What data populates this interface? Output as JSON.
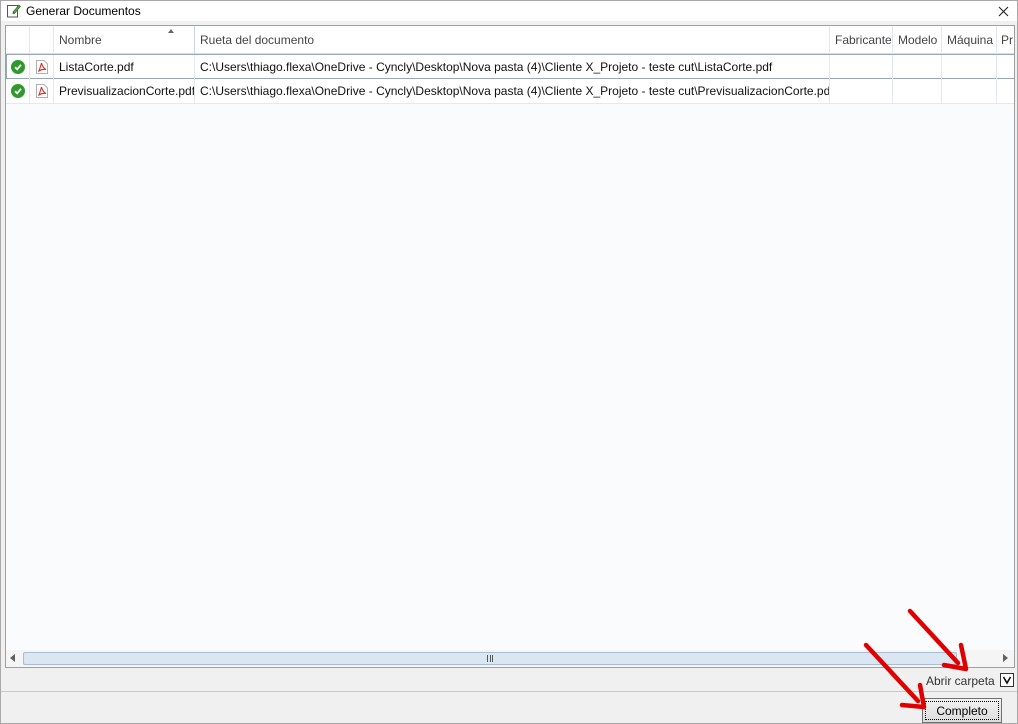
{
  "window": {
    "title": "Generar Documentos",
    "accent_color": "#5aa54a"
  },
  "grid": {
    "columns": [
      {
        "key": "status",
        "label": ""
      },
      {
        "key": "type",
        "label": ""
      },
      {
        "key": "name",
        "label": "Nombre",
        "sorted": "ascending"
      },
      {
        "key": "path",
        "label": "Rueta del documento"
      },
      {
        "key": "manufacturer",
        "label": "Fabricante"
      },
      {
        "key": "model",
        "label": "Modelo"
      },
      {
        "key": "machine",
        "label": "Máquina"
      },
      {
        "key": "extra",
        "label": "Pr"
      }
    ],
    "rows": [
      {
        "status_icon": "check-circle-icon",
        "type_icon": "pdf-icon",
        "name": "ListaCorte.pdf",
        "path": "C:\\Users\\thiago.flexa\\OneDrive - Cyncly\\Desktop\\Nova pasta (4)\\Cliente X_Projeto - teste cut\\ListaCorte.pdf",
        "manufacturer": "",
        "model": "",
        "machine": "",
        "extra": "",
        "selected": true
      },
      {
        "status_icon": "check-circle-icon",
        "type_icon": "pdf-icon",
        "name": "PrevisualizacionCorte.pdf",
        "path": "C:\\Users\\thiago.flexa\\OneDrive - Cyncly\\Desktop\\Nova pasta (4)\\Cliente X_Projeto - teste cut\\PrevisualizacionCorte.pdf",
        "manufacturer": "",
        "model": "",
        "machine": "",
        "extra": "",
        "selected": false
      }
    ]
  },
  "footer": {
    "open_folder_label": "Abrir carpeta",
    "open_folder_checked": true,
    "complete_button_label": "Completo"
  },
  "colors": {
    "status_ok": "#2e9a2e",
    "pdf_red": "#d2312b",
    "annotation_arrow": "#e00000"
  }
}
